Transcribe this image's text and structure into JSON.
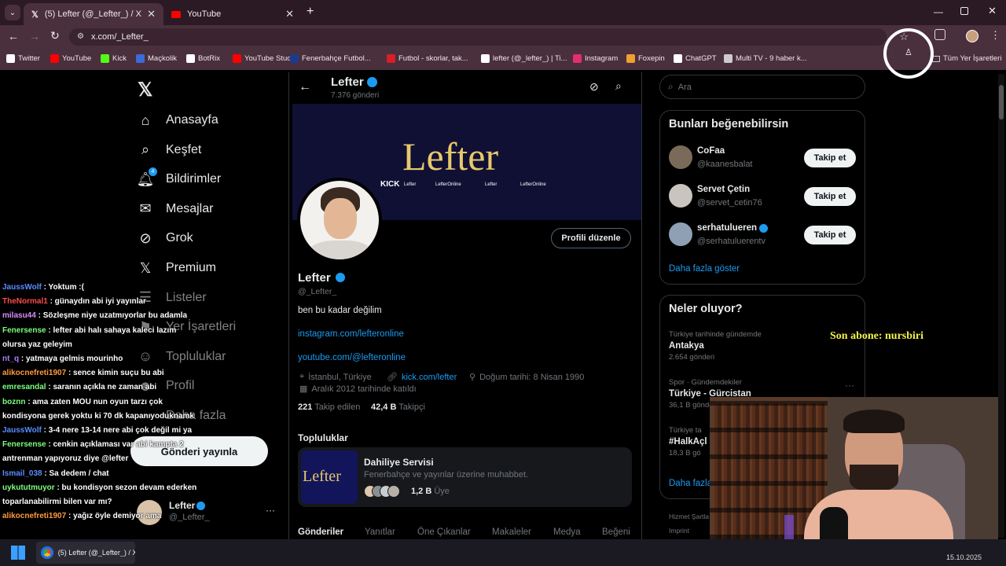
{
  "browser": {
    "tabs": [
      {
        "title": "(5) Lefter (@_Lefter_) / X",
        "active": true
      },
      {
        "title": "YouTube",
        "active": false
      }
    ],
    "url": "x.com/_Lefter_",
    "bookmarks": [
      {
        "label": "Twitter",
        "color": "#ffffff"
      },
      {
        "label": "YouTube",
        "color": "#ff0000"
      },
      {
        "label": "Kick",
        "color": "#53fc18"
      },
      {
        "label": "Maçkolik",
        "color": "#3a6bd6"
      },
      {
        "label": "BotRix",
        "color": "#ffffff"
      },
      {
        "label": "YouTube Studio",
        "color": "#ff0000"
      },
      {
        "label": "Fenerbahçe Futbol...",
        "color": "#1b3c8c"
      },
      {
        "label": "Futbol - skorlar, tak...",
        "color": "#d61f26"
      },
      {
        "label": "lefter (@_lefter_) | Ti...",
        "color": "#ffffff"
      },
      {
        "label": "Instagram",
        "color": "#e1306c"
      },
      {
        "label": "Foxepin",
        "color": "#f0a030"
      },
      {
        "label": "ChatGPT",
        "color": "#ffffff"
      },
      {
        "label": "Multi TV - 9 haber k...",
        "color": "#cccccc"
      }
    ],
    "all_bookmarks": "Tüm Yer İşaretleri"
  },
  "nav": {
    "items": [
      {
        "label": "Anasayfa",
        "icon": "home-icon"
      },
      {
        "label": "Keşfet",
        "icon": "search-icon"
      },
      {
        "label": "Bildirimler",
        "icon": "bell-icon",
        "badge": "4"
      },
      {
        "label": "Mesajlar",
        "icon": "mail-icon"
      },
      {
        "label": "Grok",
        "icon": "grok-icon"
      },
      {
        "label": "Premium",
        "icon": "x-icon"
      },
      {
        "label": "Listeler",
        "icon": "list-icon"
      },
      {
        "label": "Yer İşaretleri",
        "icon": "bookmark-icon"
      },
      {
        "label": "Topluluklar",
        "icon": "people-icon"
      },
      {
        "label": "Profil",
        "icon": "user-icon"
      },
      {
        "label": "Daha fazla",
        "icon": "more-icon"
      }
    ],
    "post_button": "Gönderi yayınla",
    "account": {
      "name": "Lefter",
      "handle": "@_Lefter_"
    }
  },
  "profile": {
    "name": "Lefter",
    "post_count": "7.376 gönderi",
    "handle": "@_Lefter_",
    "bio": "ben bu kadar değilim",
    "links": [
      "instagram.com/lefteronline",
      "youtube.com/@lefteronline"
    ],
    "location": "İstanbul, Türkiye",
    "website": "kick.com/lefter",
    "birthday": "Doğum tarihi: 8 Nisan 1990",
    "joined": "Aralık 2012 tarihinde katıldı",
    "following_count": "221",
    "following_label": "Takip edilen",
    "followers_count": "42,4 B",
    "followers_label": "Takipçi",
    "edit_button": "Profili düzenle",
    "banner": {
      "title": "Lefter",
      "socials": [
        "KICK",
        "Lefter",
        "LefterOnline",
        "Lefter",
        "LefterOnline"
      ]
    }
  },
  "communities": {
    "heading": "Topluluklar",
    "name": "Dahiliye Servisi",
    "desc": "Fenerbahçe ve yayınlar üzerine muhabbet.",
    "members": "1,2 B",
    "members_label": "Üye",
    "thumb_text": "Lefter"
  },
  "profile_tabs": [
    "Gönderiler",
    "Yanıtlar",
    "Öne Çıkanlar",
    "Makaleler",
    "Medya",
    "Beğeni"
  ],
  "sidebar": {
    "search_placeholder": "Ara",
    "suggest_title": "Bunları beğenebilirsin",
    "suggestions": [
      {
        "name": "CoFaa",
        "handle": "@kaanesbalat",
        "verified": false
      },
      {
        "name": "Servet Çetin",
        "handle": "@servet_cetin76",
        "verified": false
      },
      {
        "name": "serhatulueren",
        "handle": "@serhatuluerentv",
        "verified": true
      }
    ],
    "follow_label": "Takip et",
    "show_more": "Daha fazla göster",
    "trends_title": "Neler oluyor?",
    "trends": [
      {
        "context": "Türkiye tarihinde gündemde",
        "topic": "Antakya",
        "count": "2.654 gönderi"
      },
      {
        "context": "Spor · Gündemdekiler",
        "topic": "Türkiye - Gürcistan",
        "count": "36,1 B gönderi"
      },
      {
        "context": "Türkiye ta",
        "topic": "#HalkAçl",
        "count": "18,3 B gö"
      }
    ],
    "trends_more": "Daha fazla",
    "footer": [
      "Hizmet Şartla",
      "Imprint"
    ]
  },
  "stream_overlay": {
    "new_sub": "Son abone: nursbiri"
  },
  "chat": [
    {
      "user": "JaussWolf",
      "color": "#5b8cff",
      "msg": " : Yoktum :("
    },
    {
      "user": "TheNormal1",
      "color": "#ff4a4a",
      "msg": " : günaydın abi iyi yayınlar"
    },
    {
      "user": "milasu44",
      "color": "#d98cff",
      "msg": " : Sözleşme niye uzatmıyorlar bu adamla"
    },
    {
      "user": "Fenersense",
      "color": "#7cff7c",
      "msg": " : lefter abi halı sahaya kaleci lazım"
    },
    {
      "user": "",
      "color": "#ffffff",
      "msg": "olursa yaz geleyim"
    },
    {
      "user": "nt_q",
      "color": "#b07cff",
      "msg": " : yatmaya gelmis mourinho"
    },
    {
      "user": "alikocnefreti1907",
      "color": "#ff9a3c",
      "msg": " : sence kimin suçu bu abi"
    },
    {
      "user": "emresandal",
      "color": "#7cff7c",
      "msg": " : saranın açıkla ne zaman abi"
    },
    {
      "user": "boznn",
      "color": "#7cff7c",
      "msg": " : ama zaten MOU nun oyun tarzı çok"
    },
    {
      "user": "",
      "color": "#ffffff",
      "msg": "kondisyona gerek yoktu ki 70 dk kapanıyoduknamk"
    },
    {
      "user": "JaussWolf",
      "color": "#5b8cff",
      "msg": " : 3-4 nere 13-14 nere abi çok değil mi ya"
    },
    {
      "user": "Fenersense",
      "color": "#7cff7c",
      "msg": " : cenkin açıklaması var abi kampta 2"
    },
    {
      "user": "",
      "color": "#ffffff",
      "msg": "antrenman yapıyoruz diye @lefter"
    },
    {
      "user": "Ismail_038",
      "color": "#5b8cff",
      "msg": " : Sa dedem / chat"
    },
    {
      "user": "uykututmuyor",
      "color": "#7cff7c",
      "msg": " : bu kondisyon sezon devam ederken"
    },
    {
      "user": "",
      "color": "#ffffff",
      "msg": "toparlanabilirmi bilen var mı?"
    },
    {
      "user": "alikocnefreti1907",
      "color": "#ff9a3c",
      "msg": " : yağız öyle demiyor ama"
    }
  ],
  "taskbar": {
    "app": "(5) Lefter (@_Lefter_) / X",
    "date": "15.10.2025"
  }
}
